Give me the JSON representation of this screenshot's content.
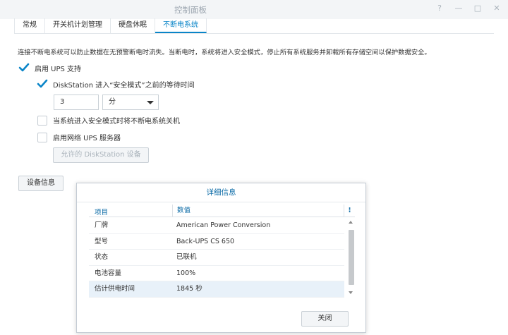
{
  "window": {
    "title": "控制面板",
    "controls": [
      "?",
      "—",
      "□",
      "✕"
    ]
  },
  "tabs": [
    {
      "label": "常规",
      "active": false
    },
    {
      "label": "开关机计划管理",
      "active": false
    },
    {
      "label": "硬盘休眠",
      "active": false
    },
    {
      "label": "不断电系统",
      "active": true
    }
  ],
  "description": "连接不断电系统可以防止数据在无预警断电时流失。当断电时，系统将进入安全模式，停止所有系统服务并卸载所有存储空间以保护数据安全。",
  "options": {
    "enable_ups": {
      "label": "启用 UPS 支持",
      "checked": true
    },
    "wait_time": {
      "label": "DiskStation 进入“安全模式”之前的等待时间",
      "checked": true,
      "value": "3",
      "unit": "分"
    },
    "shutdown_ups": {
      "label": "当系统进入安全模式时将不断电系统关机",
      "checked": false
    },
    "network_server": {
      "label": "启用网络 UPS 服务器",
      "checked": false
    },
    "allowed_devices_button": "允许的 DiskStation 设备"
  },
  "device_info_button": "设备信息",
  "dialog": {
    "title": "详细信息",
    "columns": [
      "项目",
      "数值"
    ],
    "rows": [
      {
        "key": "厂牌",
        "value": "American Power Conversion"
      },
      {
        "key": "型号",
        "value": "Back-UPS CS 650"
      },
      {
        "key": "状态",
        "value": "已联机"
      },
      {
        "key": "电池容量",
        "value": "100%"
      },
      {
        "key": "估计供电时间",
        "value": "1845 秒",
        "selected": true
      }
    ],
    "close_button": "关闭"
  },
  "colors": {
    "accent": "#0a85c8",
    "header_text": "#0a6aa6",
    "selected_row": "#e8f1f9"
  }
}
